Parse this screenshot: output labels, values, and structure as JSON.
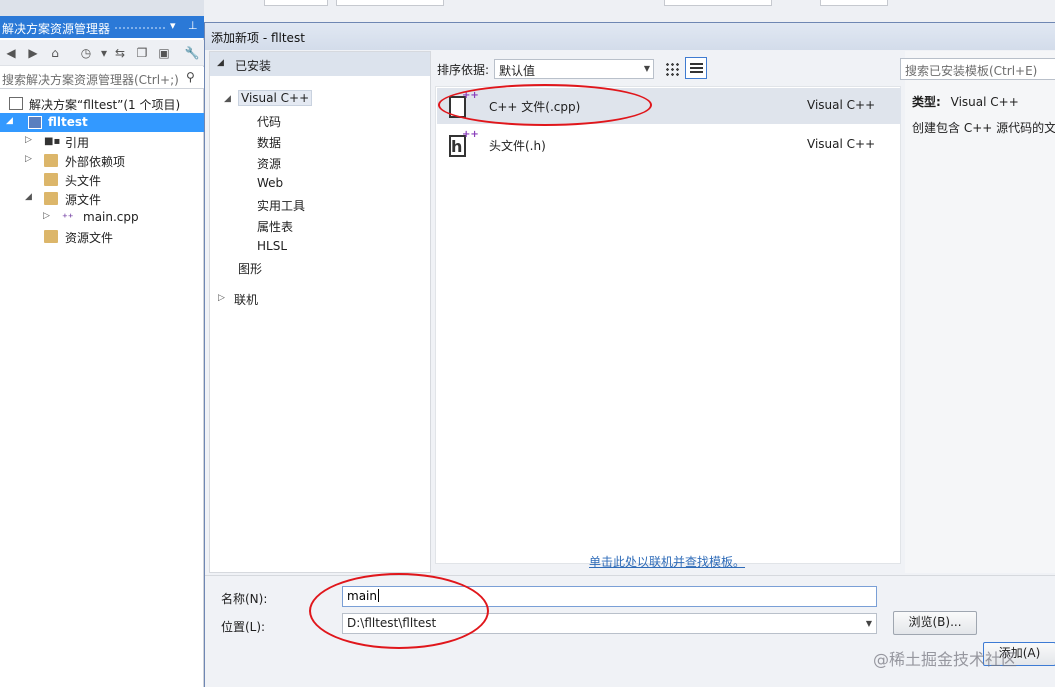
{
  "solution_explorer": {
    "title": "解决方案资源管理器",
    "pin": "ㅁ",
    "search_placeholder": "搜索解决方案资源管理器(Ctrl+;)",
    "tree": [
      {
        "label": "解决方案“flltest”(1 个项目)",
        "icon": "solution-icon"
      },
      {
        "label": "flltest",
        "icon": "project-icon",
        "selected": true
      },
      {
        "label": "引用",
        "icon": "references-icon"
      },
      {
        "label": "外部依赖项",
        "icon": "external-deps-icon"
      },
      {
        "label": "头文件",
        "icon": "folder-icon"
      },
      {
        "label": "源文件",
        "icon": "folder-icon"
      },
      {
        "label": "main.cpp",
        "icon": "cpp-file-icon"
      },
      {
        "label": "资源文件",
        "icon": "folder-icon"
      }
    ]
  },
  "dialog": {
    "title": "添加新项 - flltest",
    "installed_label": "已安装",
    "categories": {
      "visual_cpp": "Visual C++",
      "items": [
        "代码",
        "数据",
        "资源",
        "Web",
        "实用工具",
        "属性表",
        "HLSL"
      ],
      "graphics": "图形",
      "online": "联机"
    },
    "sort_label": "排序依据:",
    "sort_value": "默认值",
    "search_placeholder": "搜索已安装模板(Ctrl+E)",
    "templates": [
      {
        "name": "C++ 文件(.cpp)",
        "lang": "Visual C++",
        "icon": "cpp-file-icon",
        "selected": true
      },
      {
        "name": "头文件(.h)",
        "lang": "Visual C++",
        "icon": "header-file-icon",
        "selected": false
      }
    ],
    "detail": {
      "type_label": "类型:",
      "type_value": "Visual C++",
      "description": "创建包含 C++ 源代码的文件"
    },
    "online_link": "单击此处以联机并查找模板。",
    "name_label": "名称(N):",
    "name_value": "main",
    "location_label": "位置(L):",
    "location_value": "D:\\flltest\\flltest",
    "browse_button": "浏览(B)...",
    "add_button": "添加(A)"
  },
  "watermark": "@稀土掘金技术社区",
  "colors": {
    "accent": "#2b79d7",
    "selection": "#3399ff",
    "annotation": "#e0161b",
    "link": "#2e6bb8"
  }
}
